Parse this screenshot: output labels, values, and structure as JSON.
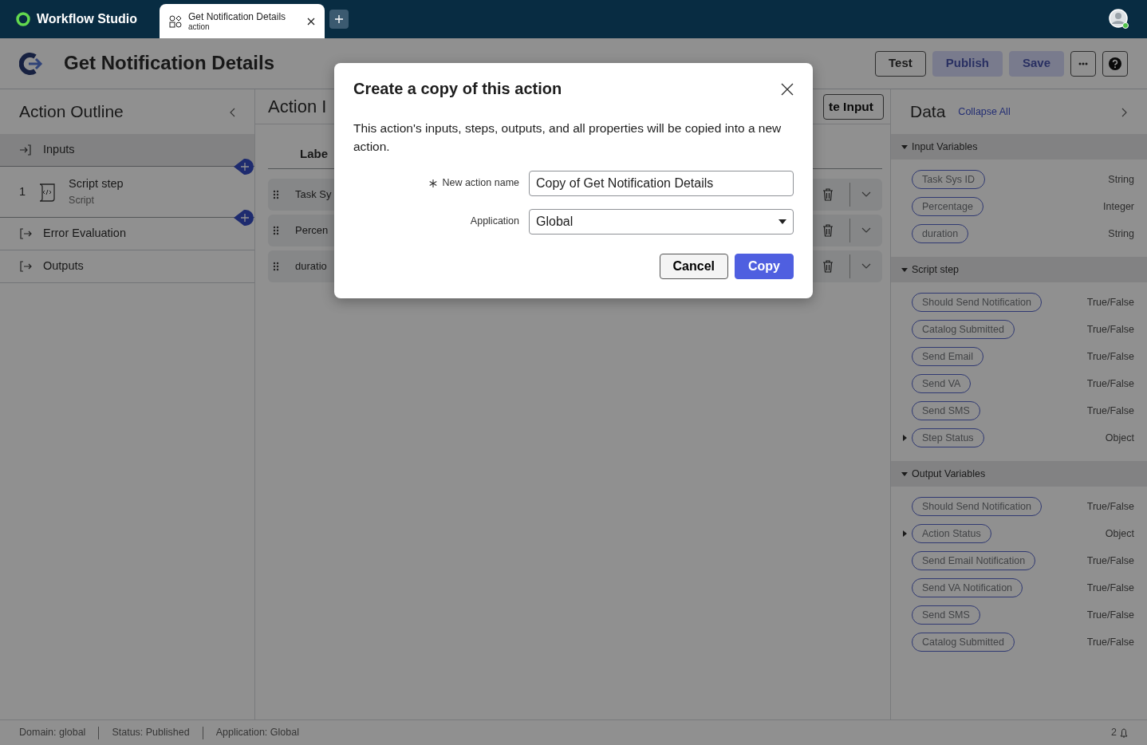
{
  "app": {
    "name": "Workflow Studio"
  },
  "tabs": [
    {
      "title": "Get Notification Details",
      "subtitle": "action",
      "selected": true
    }
  ],
  "header": {
    "title": "Get Notification Details",
    "buttons": [
      {
        "kind": "text",
        "label": "Test",
        "disabled": false
      },
      {
        "kind": "primary",
        "label": "Publish",
        "disabled": true
      },
      {
        "kind": "primary",
        "label": "Save",
        "disabled": true
      },
      {
        "kind": "more",
        "disabled": false
      },
      {
        "kind": "help",
        "disabled": false
      }
    ]
  },
  "outline": {
    "title": "Action Outline",
    "items": [
      {
        "kind": "input",
        "label": "Inputs",
        "selected": true,
        "add_after": true
      },
      {
        "kind": "step",
        "number": "1",
        "label": "Script step",
        "sublabel": "Script",
        "selected": false,
        "add_after": true
      },
      {
        "kind": "output",
        "label": "Error Evaluation",
        "selected": false,
        "add_after": false
      },
      {
        "kind": "output",
        "label": "Outputs",
        "selected": false,
        "add_after": false
      }
    ]
  },
  "center": {
    "title": "Action I",
    "button": "te Input",
    "column": "Labe",
    "rows": [
      "Task Sy",
      "Percen",
      "duratio"
    ]
  },
  "data": {
    "title": "Data",
    "link": "Collapse All",
    "sections": [
      {
        "label": "Input Variables",
        "expanded": true,
        "items": [
          {
            "kind": "plain",
            "label": "Task Sys ID",
            "type": "String"
          },
          {
            "kind": "plain",
            "label": "Percentage",
            "type": "Integer"
          },
          {
            "kind": "plain",
            "label": "duration",
            "type": "String"
          }
        ]
      },
      {
        "label": "Script step",
        "expanded": true,
        "items": [
          {
            "kind": "plain",
            "label": "Should Send Notification",
            "type": "True/False"
          },
          {
            "kind": "plain",
            "label": "Catalog Submitted",
            "type": "True/False"
          },
          {
            "kind": "plain",
            "label": "Send Email",
            "type": "True/False"
          },
          {
            "kind": "plain",
            "label": "Send VA",
            "type": "True/False"
          },
          {
            "kind": "plain",
            "label": "Send SMS",
            "type": "True/False"
          },
          {
            "kind": "object",
            "label": "Step Status",
            "type": "Object"
          }
        ]
      },
      {
        "label": "Output Variables",
        "expanded": true,
        "items": [
          {
            "kind": "plain",
            "label": "Should Send Notification",
            "type": "True/False"
          },
          {
            "kind": "object",
            "label": "Action Status",
            "type": "Object"
          },
          {
            "kind": "plain",
            "label": "Send Email Notification",
            "type": "True/False"
          },
          {
            "kind": "plain",
            "label": "Send VA Notification",
            "type": "True/False"
          },
          {
            "kind": "plain",
            "label": "Send SMS",
            "type": "True/False"
          },
          {
            "kind": "plain",
            "label": "Catalog Submitted",
            "type": "True/False"
          }
        ]
      }
    ]
  },
  "status_bar": {
    "items": [
      "Domain: global",
      "Status: Published",
      "Application: Global"
    ],
    "notifications": "2"
  },
  "dialog": {
    "title": "Create a copy of this action",
    "text": "This action's inputs, steps, outputs, and all properties will be copied into a new action.",
    "fields": [
      {
        "kind": "text",
        "label": "New action name",
        "required": true,
        "value": "Copy of Get Notification Details"
      },
      {
        "kind": "select",
        "label": "Application",
        "required": false,
        "value": "Global"
      }
    ],
    "buttons": [
      {
        "kind": "secondary",
        "label": "Cancel"
      },
      {
        "kind": "primary",
        "label": "Copy"
      }
    ]
  }
}
